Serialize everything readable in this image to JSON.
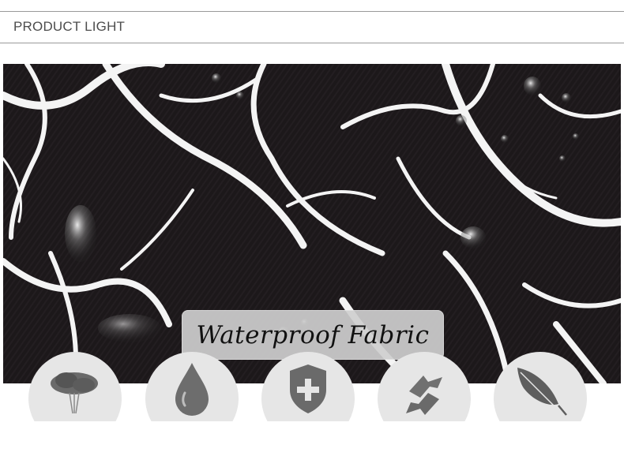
{
  "header": {
    "title": "PRODUCT LIGHT"
  },
  "banner": {
    "label": "Waterproof Fabric"
  },
  "icons": [
    {
      "name": "feather-duster-icon"
    },
    {
      "name": "water-drop-icon"
    },
    {
      "name": "shield-plus-icon"
    },
    {
      "name": "recycle-arrows-icon"
    },
    {
      "name": "feather-icon"
    }
  ]
}
